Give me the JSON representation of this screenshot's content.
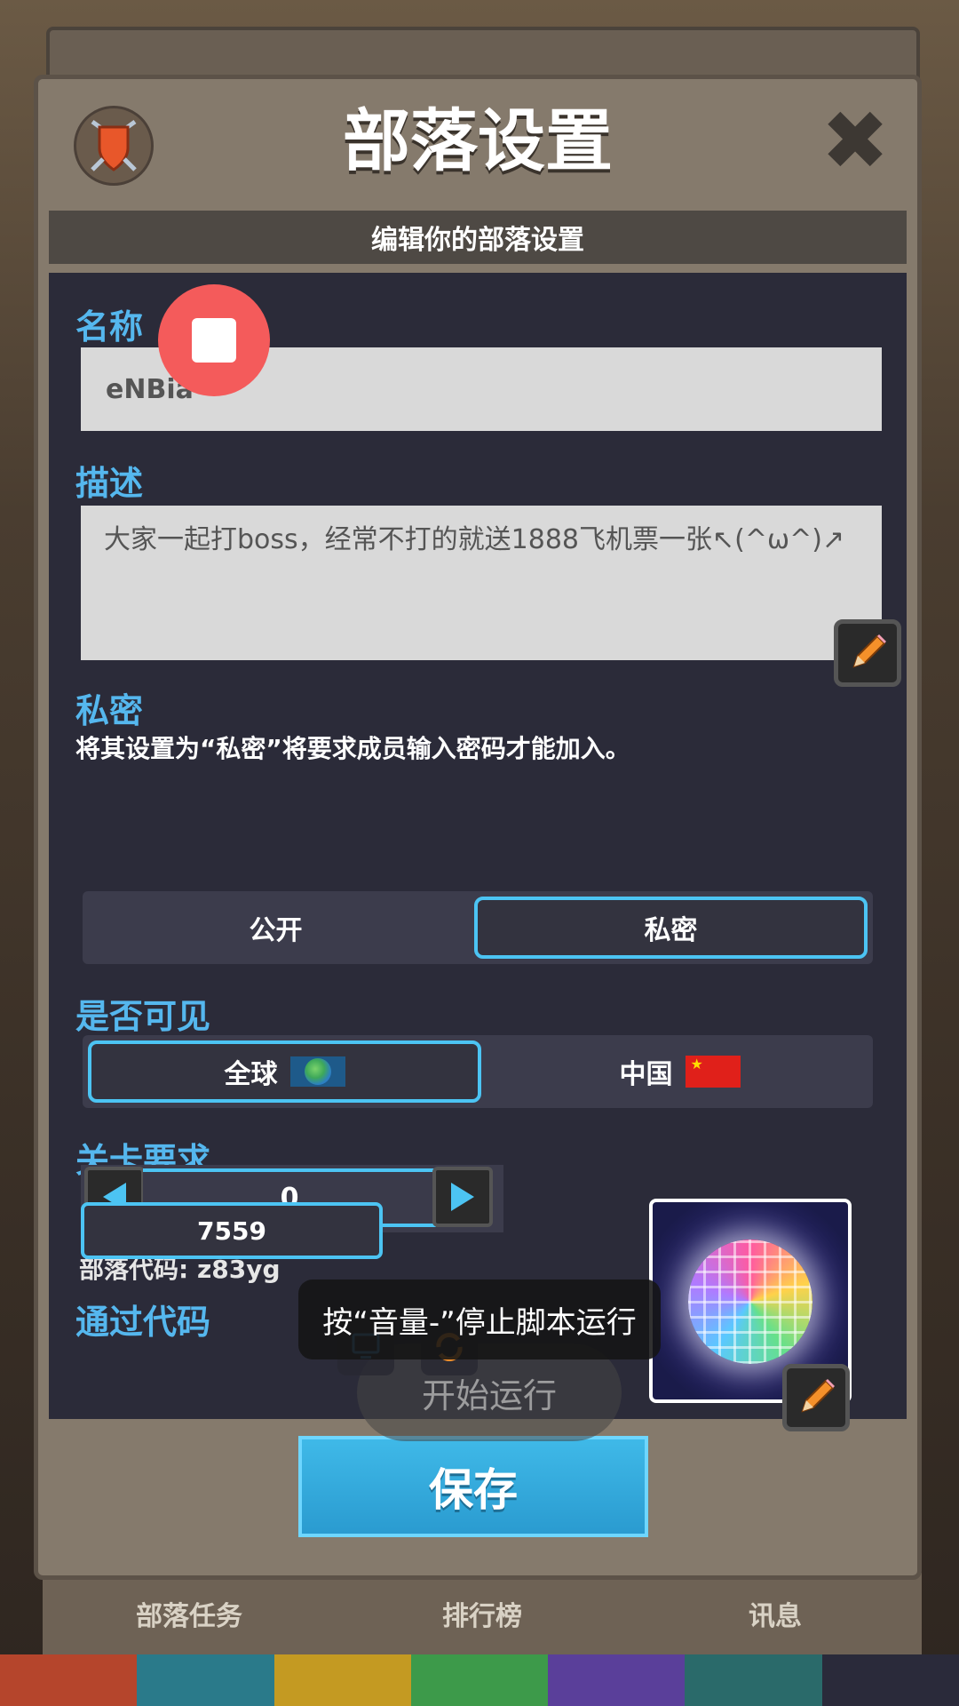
{
  "dialog": {
    "title": "部落设置",
    "subtitle": "编辑你的部落设置",
    "close_glyph": "✖"
  },
  "name": {
    "label": "名称",
    "value": "eNBia"
  },
  "description": {
    "label": "描述",
    "value": "大家一起打boss，经常不打的就送1888飞机票一张↖(^ω^)↗"
  },
  "privacy": {
    "label": "私密",
    "note": "将其设置为“私密”将要求成员输入密码才能加入。",
    "options": [
      "公开",
      "私密"
    ],
    "selected": "私密"
  },
  "visibility": {
    "label": "是否可见",
    "options": [
      "全球",
      "中国"
    ],
    "selected": "全球"
  },
  "level_requirement": {
    "label": "关卡要求",
    "value": "0"
  },
  "clan_code": "部落代码: z83yg",
  "pass_code": {
    "label": "通过代码",
    "value": "7559"
  },
  "save_label": "保存",
  "bottom_tabs": [
    "部落任务",
    "排行榜",
    "讯息"
  ],
  "overlay": {
    "toast": "按“音量-”停止脚本运行",
    "run_button": "开始运行"
  },
  "colors": {
    "accent": "#55b7ee",
    "selected_border": "#4cc4f3",
    "save_button": "#2a9bd0",
    "record_button": "#f45b5b"
  }
}
